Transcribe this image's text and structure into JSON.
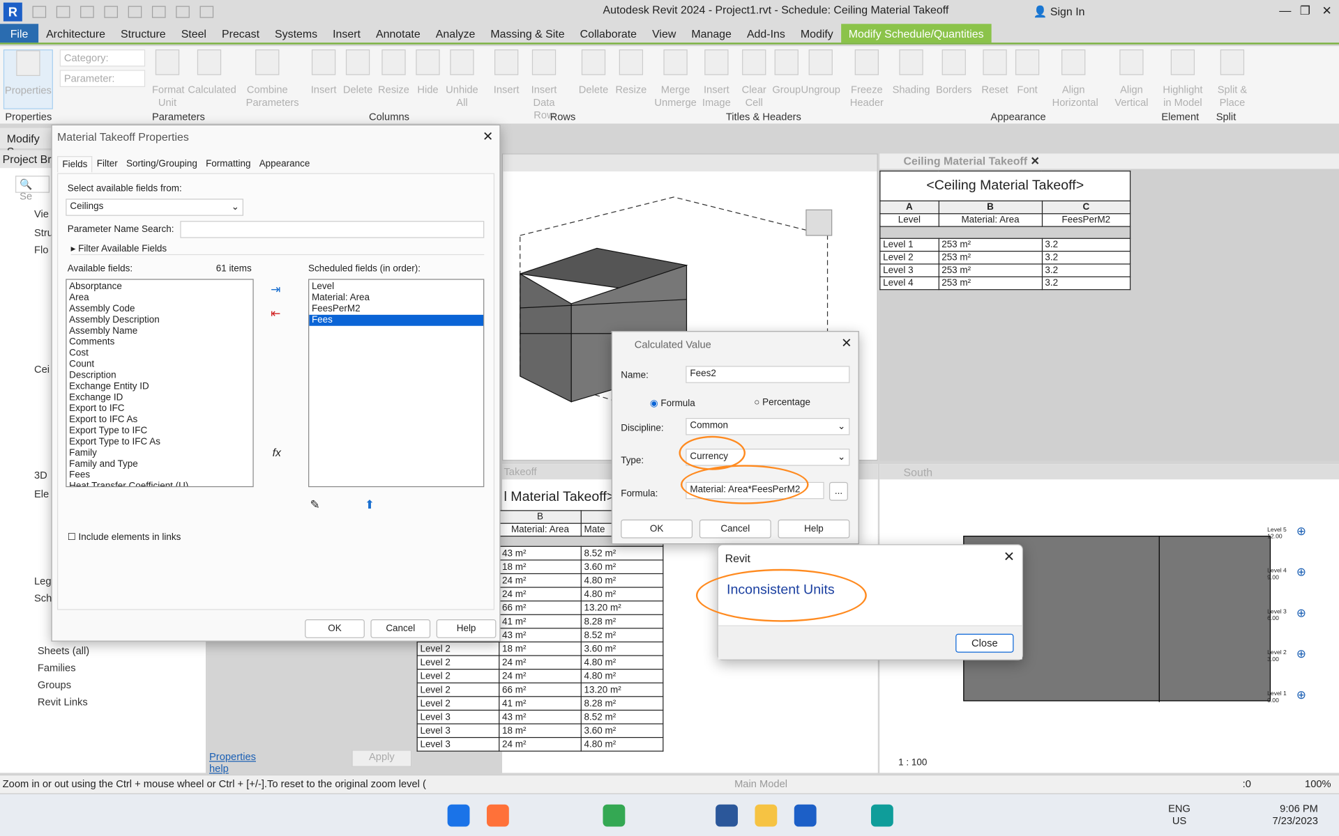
{
  "app": {
    "title": "Autodesk Revit 2024 - Project1.rvt - Schedule: Ceiling Material Takeoff",
    "sign_in": "Sign In",
    "logo": "R"
  },
  "menu": [
    "File",
    "Architecture",
    "Structure",
    "Steel",
    "Precast",
    "Systems",
    "Insert",
    "Annotate",
    "Analyze",
    "Massing & Site",
    "Collaborate",
    "View",
    "Manage",
    "Add-Ins",
    "Modify",
    "Modify Schedule/Quantities"
  ],
  "ribbon": {
    "category_placeholder": "Category:",
    "parameter_placeholder": "Parameter:",
    "buttons": [
      "Properties",
      "Format Unit",
      "Calculated",
      "Combine Parameters",
      "Insert",
      "Delete",
      "Resize",
      "Hide",
      "Unhide All",
      "Insert",
      "Insert Data Row",
      "Delete",
      "Resize",
      "Merge Unmerge",
      "Insert Image",
      "Clear Cell",
      "Group",
      "Ungroup",
      "Freeze Header",
      "Shading",
      "Borders",
      "Reset",
      "Font",
      "Align Horizontal",
      "Align Vertical",
      "Highlight in Model",
      "Split & Place"
    ],
    "groups": [
      "Properties",
      "Parameters",
      "Columns",
      "Rows",
      "Titles & Headers",
      "Appearance",
      "Element",
      "Split"
    ]
  },
  "modify_bar": "Modify S",
  "project_browser": {
    "title": "Project Bro",
    "search": "Se",
    "items": [
      "Vie",
      "Stru",
      "Flo",
      "Cei",
      "3D",
      "Ele",
      "Leg",
      "Sch",
      "Sheets (all)",
      "Families",
      "Groups",
      "Revit Links"
    ]
  },
  "properties_help": "Properties help",
  "apply": "Apply",
  "takeoff_dialog": {
    "title": "Material Takeoff Properties",
    "tabs": [
      "Fields",
      "Filter",
      "Sorting/Grouping",
      "Formatting",
      "Appearance"
    ],
    "select_label": "Select available fields from:",
    "select_value": "Ceilings",
    "param_search_label": "Parameter Name Search:",
    "filter_label": "Filter Available Fields",
    "available_label": "Available fields:",
    "count": "61 items",
    "available": [
      "Absorptance",
      "Area",
      "Assembly Code",
      "Assembly Description",
      "Assembly Name",
      "Comments",
      "Cost",
      "Count",
      "Description",
      "Exchange Entity ID",
      "Exchange ID",
      "Export to IFC",
      "Export to IFC As",
      "Export Type to IFC",
      "Export Type to IFC As",
      "Family",
      "Family and Type",
      "Fees",
      "Heat Transfer Coefficient (U)"
    ],
    "scheduled_label": "Scheduled fields (in order):",
    "scheduled": [
      "Level",
      "Material: Area",
      "FeesPerM2",
      "Fees"
    ],
    "include_links": "Include elements in links",
    "ok": "OK",
    "cancel": "Cancel",
    "help": "Help"
  },
  "calc_dialog": {
    "title": "Calculated Value",
    "name_label": "Name:",
    "name": "Fees2",
    "formula_radio": "Formula",
    "percentage_radio": "Percentage",
    "discipline_label": "Discipline:",
    "discipline": "Common",
    "type_label": "Type:",
    "type": "Currency",
    "formula_label": "Formula:",
    "formula": "Material: Area*FeesPerM2",
    "browse": "...",
    "ok": "OK",
    "cancel": "Cancel",
    "help": "Help"
  },
  "error_dialog": {
    "title": "Revit",
    "message": "Inconsistent Units",
    "close": "Close"
  },
  "schedule": {
    "tab": "Ceiling Material Takeoff",
    "title": "<Ceiling Material Takeoff>",
    "letters": [
      "A",
      "B",
      "C"
    ],
    "headers": [
      "Level",
      "Material: Area",
      "FeesPerM2"
    ],
    "rows": [
      [
        "Level 1",
        "253 m²",
        "3.2"
      ],
      [
        "Level 2",
        "253 m²",
        "3.2"
      ],
      [
        "Level 3",
        "253 m²",
        "3.2"
      ],
      [
        "Level 4",
        "253 m²",
        "3.2"
      ]
    ]
  },
  "lower_schedule": {
    "tab": "Takeoff",
    "title": "l Material Takeoff>",
    "col_b": "B",
    "header_b": "Material: Area",
    "header_c": "Mate",
    "rows": [
      [
        "",
        "43 m²",
        "8.52 m²"
      ],
      [
        "",
        "18 m²",
        "3.60 m²"
      ],
      [
        "",
        "24 m²",
        "4.80 m²"
      ],
      [
        "",
        "24 m²",
        "4.80 m²"
      ],
      [
        "",
        "66 m²",
        "13.20 m²"
      ],
      [
        "",
        "41 m²",
        "8.28 m²"
      ],
      [
        "Level 2",
        "43 m²",
        "8.52 m²"
      ],
      [
        "Level 2",
        "18 m²",
        "3.60 m²"
      ],
      [
        "Level 2",
        "24 m²",
        "4.80 m²"
      ],
      [
        "Level 2",
        "24 m²",
        "4.80 m²"
      ],
      [
        "Level 2",
        "66 m²",
        "13.20 m²"
      ],
      [
        "Level 2",
        "41 m²",
        "8.28 m²"
      ],
      [
        "Level 3",
        "43 m²",
        "8.52 m²"
      ],
      [
        "Level 3",
        "18 m²",
        "3.60 m²"
      ],
      [
        "Level 3",
        "24 m²",
        "4.80 m²"
      ]
    ]
  },
  "south_view": {
    "tab": "South",
    "scale": "1 : 100",
    "levels": [
      [
        "Level 5",
        "12.00"
      ],
      [
        "Level 4",
        "9.00"
      ],
      [
        "Level 3",
        "6.00"
      ],
      [
        "Level 2",
        "3.00"
      ],
      [
        "Level 1",
        "0.00"
      ]
    ]
  },
  "status": {
    "hint": "Zoom in or out using the Ctrl + mouse wheel or Ctrl + [+/-].To reset to the original zoom level (",
    "model": "Main Model",
    "sel0": ":0",
    "filter0": ":0",
    "zoom": "100%"
  },
  "taskbar": {
    "lang": "ENG",
    "region": "US",
    "time": "9:06 PM",
    "date": "7/23/2023"
  },
  "colors": {
    "accent": "#8bc34a",
    "file": "#2a6cb0",
    "selection": "#0a64d6",
    "annotation": "#ff8a1f",
    "error_text": "#1a3fa0"
  }
}
